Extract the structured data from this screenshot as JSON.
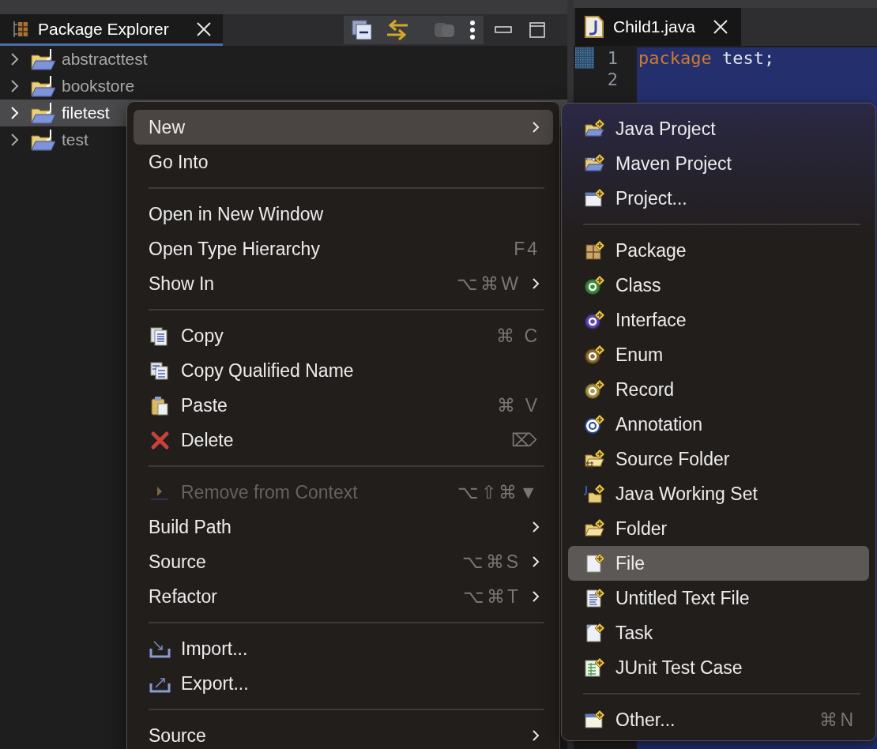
{
  "explorer": {
    "tab": {
      "label": "Package Explorer",
      "selected": true
    },
    "tree": [
      {
        "label": "abstracttest",
        "selected": false,
        "expanded": false
      },
      {
        "label": "bookstore",
        "selected": false,
        "expanded": false
      },
      {
        "label": "filetest",
        "selected": true,
        "expanded": false
      },
      {
        "label": "test",
        "selected": false,
        "expanded": false
      }
    ]
  },
  "editor": {
    "tab": {
      "label": "Child1.java",
      "selected": true
    },
    "lines": [
      {
        "number": "1",
        "tokens": [
          {
            "text": "package",
            "kind": "keyword"
          },
          {
            "text": " test;",
            "kind": "plain"
          }
        ]
      },
      {
        "number": "2"
      }
    ]
  },
  "context_menu": {
    "items": [
      {
        "kind": "item",
        "label": "New",
        "submenu": true,
        "selected": true,
        "disabled": false
      },
      {
        "kind": "item",
        "label": "Go Into",
        "submenu": false,
        "selected": false,
        "disabled": false
      },
      {
        "kind": "separator"
      },
      {
        "kind": "item",
        "label": "Open in New Window",
        "submenu": false,
        "selected": false,
        "disabled": false
      },
      {
        "kind": "item",
        "label": "Open Type Hierarchy",
        "shortcut": "F4",
        "submenu": false,
        "selected": false,
        "disabled": false
      },
      {
        "kind": "item",
        "label": "Show In",
        "shortcut": "⌥⌘W",
        "submenu": true,
        "selected": false,
        "disabled": false
      },
      {
        "kind": "separator"
      },
      {
        "kind": "item",
        "label": "Copy",
        "shortcut": "⌘ C",
        "submenu": false,
        "selected": false,
        "disabled": false
      },
      {
        "kind": "item",
        "label": "Copy Qualified Name",
        "submenu": false,
        "selected": false,
        "disabled": false
      },
      {
        "kind": "item",
        "label": "Paste",
        "shortcut": "⌘ V",
        "submenu": false,
        "selected": false,
        "disabled": false
      },
      {
        "kind": "item",
        "label": "Delete",
        "shortcut": "⌦",
        "submenu": false,
        "selected": false,
        "disabled": false
      },
      {
        "kind": "separator"
      },
      {
        "kind": "item",
        "label": "Remove from Context",
        "shortcut": "⌥⇧⌘▼",
        "submenu": false,
        "selected": false,
        "disabled": true
      },
      {
        "kind": "item",
        "label": "Build Path",
        "submenu": true,
        "selected": false,
        "disabled": false
      },
      {
        "kind": "item",
        "label": "Source",
        "shortcut": "⌥⌘S",
        "submenu": true,
        "selected": false,
        "disabled": false
      },
      {
        "kind": "item",
        "label": "Refactor",
        "shortcut": "⌥⌘T",
        "submenu": true,
        "selected": false,
        "disabled": false
      },
      {
        "kind": "separator"
      },
      {
        "kind": "item",
        "label": "Import...",
        "submenu": false,
        "selected": false,
        "disabled": false
      },
      {
        "kind": "item",
        "label": "Export...",
        "submenu": false,
        "selected": false,
        "disabled": false
      },
      {
        "kind": "separator"
      },
      {
        "kind": "item",
        "label": "Source",
        "submenu": true,
        "selected": false,
        "disabled": false
      }
    ]
  },
  "new_submenu": {
    "items": [
      {
        "kind": "item",
        "label": "Java Project",
        "selected": false
      },
      {
        "kind": "item",
        "label": "Maven Project",
        "selected": false
      },
      {
        "kind": "item",
        "label": "Project...",
        "selected": false
      },
      {
        "kind": "separator"
      },
      {
        "kind": "item",
        "label": "Package",
        "selected": false
      },
      {
        "kind": "item",
        "label": "Class",
        "selected": false
      },
      {
        "kind": "item",
        "label": "Interface",
        "selected": false
      },
      {
        "kind": "item",
        "label": "Enum",
        "selected": false
      },
      {
        "kind": "item",
        "label": "Record",
        "selected": false
      },
      {
        "kind": "item",
        "label": "Annotation",
        "selected": false
      },
      {
        "kind": "item",
        "label": "Source Folder",
        "selected": false
      },
      {
        "kind": "item",
        "label": "Java Working Set",
        "selected": false
      },
      {
        "kind": "item",
        "label": "Folder",
        "selected": false
      },
      {
        "kind": "item",
        "label": "File",
        "selected": true
      },
      {
        "kind": "item",
        "label": "Untitled Text File",
        "selected": false
      },
      {
        "kind": "item",
        "label": "Task",
        "selected": false
      },
      {
        "kind": "item",
        "label": "JUnit Test Case",
        "selected": false
      },
      {
        "kind": "separator"
      },
      {
        "kind": "item",
        "label": "Other...",
        "shortcut": "⌘N",
        "selected": false
      }
    ]
  }
}
